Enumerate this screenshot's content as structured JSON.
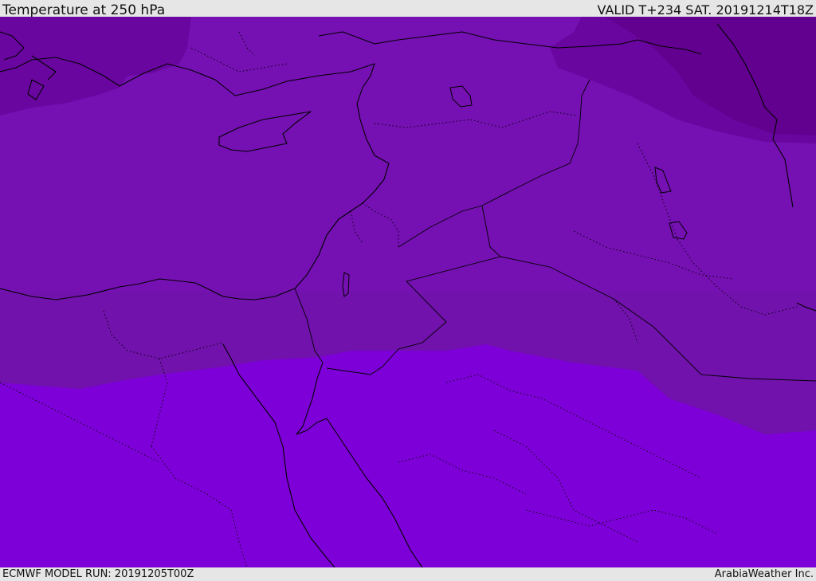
{
  "header": {
    "title": "Temperature at 250 hPa",
    "valid_time": "VALID T+234 SAT. 20191214T18Z"
  },
  "footer": {
    "model_run": "ECMWF MODEL RUN: 20191205T00Z",
    "credit": "ArabiaWeather Inc."
  },
  "map": {
    "field": "Temperature at 250 hPa",
    "colors": {
      "coldest_band": "#62008f",
      "cold_band": "#7510b2",
      "mid_band": "#6f12aa",
      "warm_band": "#7e00d8",
      "coastline": "#000000"
    },
    "features": [
      "coastline",
      "country-borders",
      "lakes"
    ]
  }
}
